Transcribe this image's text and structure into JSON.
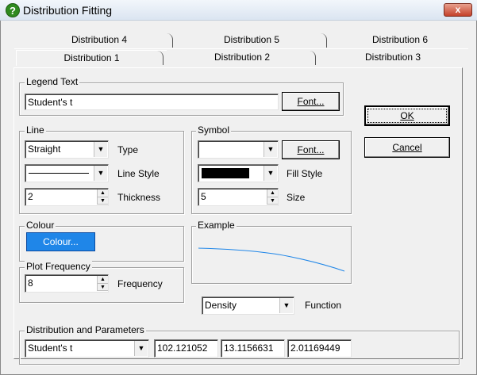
{
  "window": {
    "title": "Distribution Fitting",
    "close_label": "x",
    "help_label": "?"
  },
  "tabs": {
    "row_back": [
      "Distribution 4",
      "Distribution 5",
      "Distribution 6"
    ],
    "row_front": [
      "Distribution 1",
      "Distribution 2",
      "Distribution 3"
    ],
    "active": "Distribution 1"
  },
  "legend": {
    "group_label": "Legend Text",
    "value": "Student's t",
    "font_button": "Font..."
  },
  "line": {
    "group_label": "Line",
    "type_value": "Straight",
    "type_label": "Type",
    "style_label": "Line Style",
    "thickness_value": "2",
    "thickness_label": "Thickness"
  },
  "symbol": {
    "group_label": "Symbol",
    "font_button": "Font...",
    "fill_label": "Fill Style",
    "size_value": "5",
    "size_label": "Size"
  },
  "colour": {
    "group_label": "Colour",
    "button": "Colour...",
    "color": "#1f86e8"
  },
  "example": {
    "group_label": "Example",
    "line_color": "#1f86e8"
  },
  "plot_frequency": {
    "group_label": "Plot Frequency",
    "value": "8",
    "label": "Frequency"
  },
  "function": {
    "value": "Density",
    "label": "Function"
  },
  "distribution": {
    "group_label": "Distribution and Parameters",
    "value": "Student's t",
    "params": [
      "102.121052",
      "13.1156631",
      "2.01169449"
    ]
  },
  "buttons": {
    "ok": "OK",
    "cancel": "Cancel"
  }
}
